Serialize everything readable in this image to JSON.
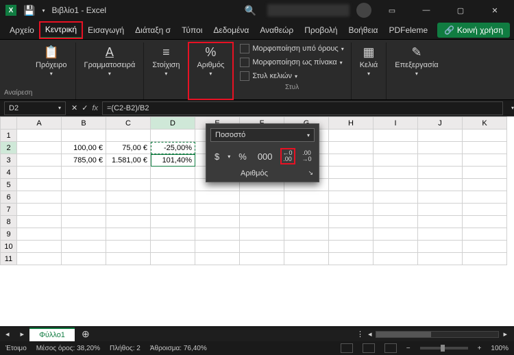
{
  "title": "Βιβλίο1 - Excel",
  "window": {
    "minimize": "—",
    "maximize": "▢",
    "close": "✕"
  },
  "tabs": {
    "file": "Αρχείο",
    "home": "Κεντρική",
    "insert": "Εισαγωγή",
    "layout": "Διάταξη σ",
    "formulas": "Τύποι",
    "data": "Δεδομένα",
    "review": "Αναθεώρ",
    "view": "Προβολή",
    "help": "Βοήθεια",
    "pdf": "PDFeleme"
  },
  "share_label": "Κοινή χρήση",
  "ribbon": {
    "undo_label": "Αναίρεση",
    "clipboard": "Πρόχειρο",
    "font": "Γραμματοσειρά",
    "align": "Στοίχιση",
    "number": "Αριθμός",
    "styles_label": "Στυλ",
    "cond_fmt": "Μορφοποίηση υπό όρους",
    "as_table": "Μορφοποίηση ως πίνακα",
    "cell_styles": "Στυλ κελιών",
    "cells": "Κελιά",
    "editing": "Επεξεργασία"
  },
  "name_box": "D2",
  "formula": "=(C2-B2)/B2",
  "columns": [
    "A",
    "B",
    "C",
    "D",
    "E",
    "F",
    "G",
    "H",
    "I",
    "J",
    "K"
  ],
  "rows": [
    "1",
    "2",
    "3",
    "4",
    "5",
    "6",
    "7",
    "8",
    "9",
    "10",
    "11"
  ],
  "cells": {
    "B2": "100,00 €",
    "C2": "75,00 €",
    "D2": "-25,00%",
    "B3": "785,00 €",
    "C3": "1.581,00 €",
    "D3": "101,40%"
  },
  "flyout": {
    "format_name": "Ποσοστό",
    "currency": "$",
    "percent": "%",
    "comma": "000",
    "inc_dec": "←0\n.00",
    "dec_dec": ".00\n→0",
    "label": "Αριθμός"
  },
  "sheet_tab": "Φύλλο1",
  "status": {
    "ready": "Έτοιμο",
    "avg_label": "Μέσος όρος:",
    "avg_val": "38,20%",
    "count_label": "Πλήθος:",
    "count_val": "2",
    "sum_label": "Άθροισμα:",
    "sum_val": "76,40%",
    "zoom": "100%"
  }
}
